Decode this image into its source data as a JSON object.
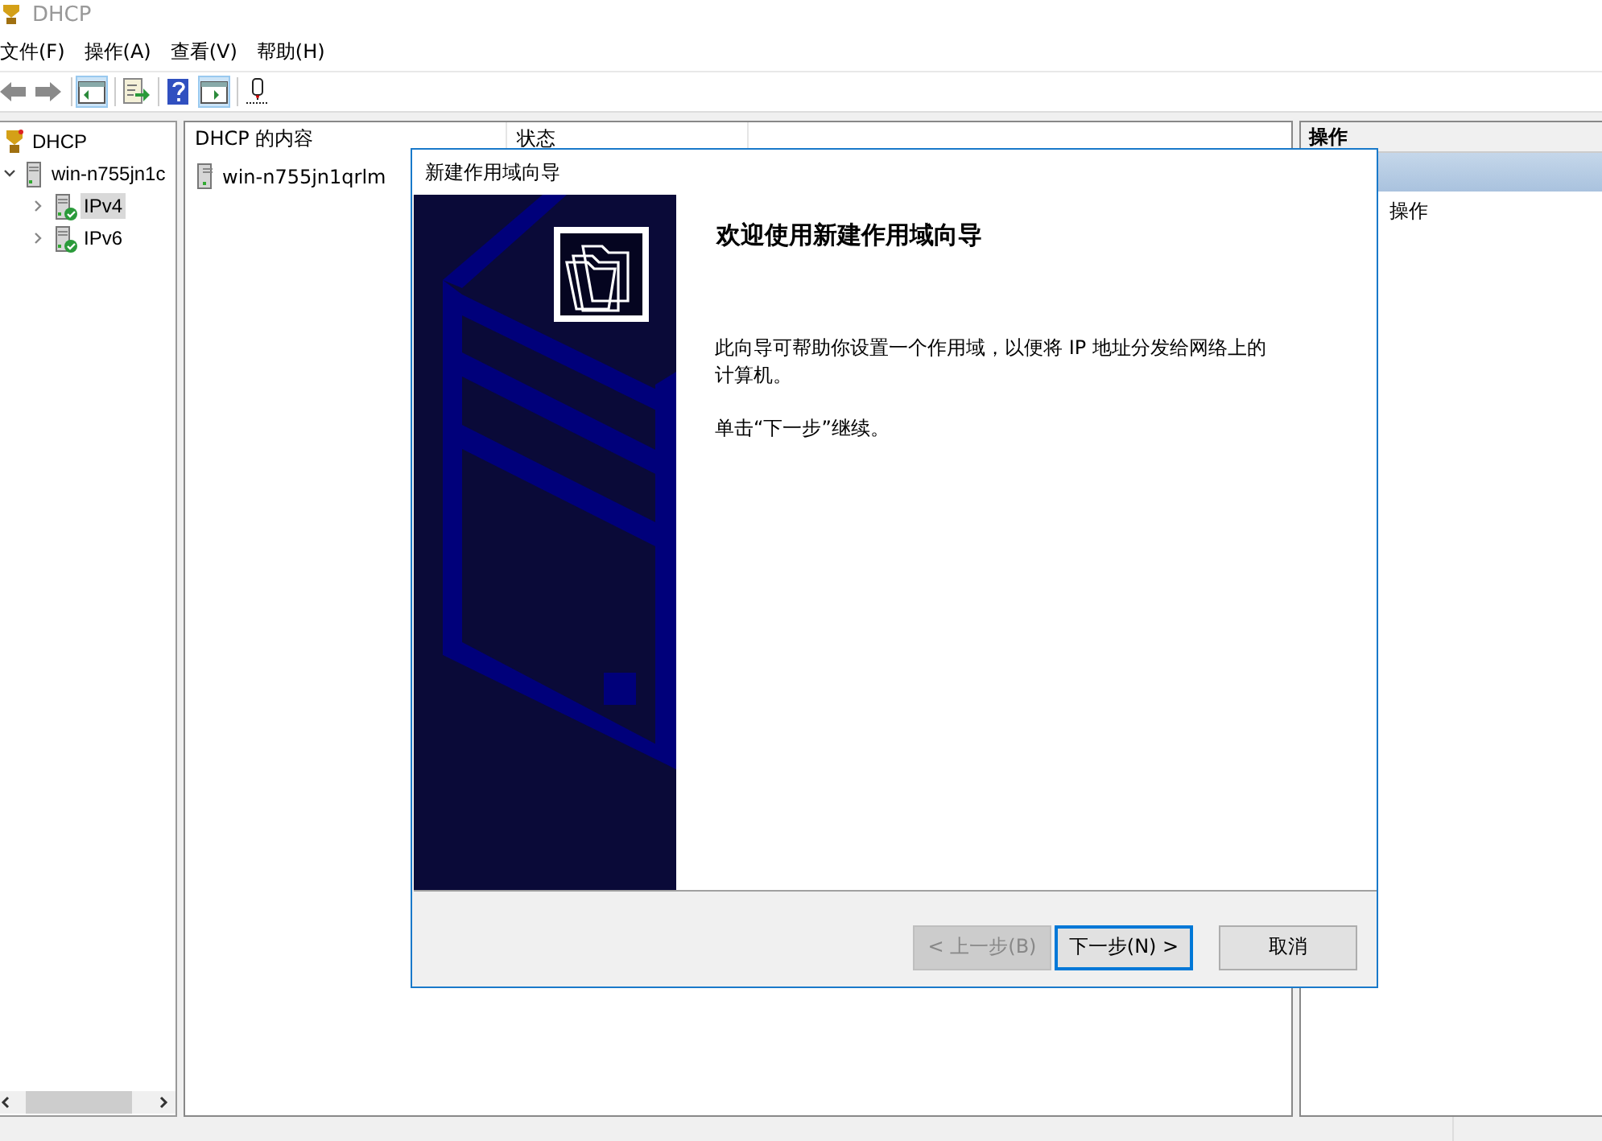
{
  "window": {
    "title": "DHCP"
  },
  "menu": [
    "文件(F)",
    "操作(A)",
    "查看(V)",
    "帮助(H)"
  ],
  "toolbar": [
    {
      "kind": "back",
      "pressed": false
    },
    {
      "kind": "forward",
      "pressed": false
    },
    {
      "kind": "tree",
      "pressed": true
    },
    {
      "kind": "export",
      "pressed": false
    },
    {
      "kind": "help",
      "pressed": false
    },
    {
      "kind": "pane",
      "pressed": true
    },
    {
      "kind": "server",
      "pressed": false
    }
  ],
  "tree": [
    {
      "label": "DHCP",
      "kind": "root",
      "children": [
        {
          "label": "win-n755jn1c",
          "kind": "server",
          "expanded": true,
          "children": [
            {
              "label": "IPv4",
              "kind": "protocol",
              "expanded": false,
              "selected": true
            },
            {
              "label": "IPv6",
              "kind": "protocol",
              "expanded": false,
              "selected": false
            }
          ]
        }
      ]
    }
  ],
  "content": {
    "columns": [
      "DHCP 的内容",
      "状态"
    ],
    "rows": [
      {
        "name": "win-n755jn1qrlm"
      }
    ]
  },
  "actions": {
    "header": "操作",
    "items": [
      "操作"
    ]
  },
  "dialog": {
    "title": "新建作用域向导",
    "heading": "欢迎使用新建作用域向导",
    "paragraphs": [
      "此向导可帮助你设置一个作用域，以便将 IP 地址分发给网络上的计算机。",
      "单击“下一步”继续。"
    ],
    "buttons": [
      {
        "label": "< 上一步(B)",
        "disabled": true,
        "default": false
      },
      {
        "label": "下一步(N) >",
        "disabled": false,
        "default": true
      },
      {
        "label": "取消",
        "disabled": false,
        "default": false
      }
    ]
  }
}
